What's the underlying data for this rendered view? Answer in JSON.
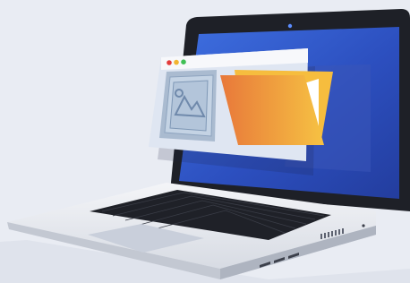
{
  "illustration": {
    "subject": "laptop-with-floating-browser-window",
    "icons": [
      "image-icon",
      "folder-icon"
    ],
    "colors": {
      "background": "#e9ecf3",
      "screen_blue": "#2f57c9",
      "bezel": "#1e2027",
      "folder_orange": "#ee8a3c",
      "folder_yellow": "#f6bd3e",
      "window_dot_red": "#e33b3b",
      "window_dot_yellow": "#f2b431",
      "window_dot_green": "#3fbf55"
    }
  }
}
